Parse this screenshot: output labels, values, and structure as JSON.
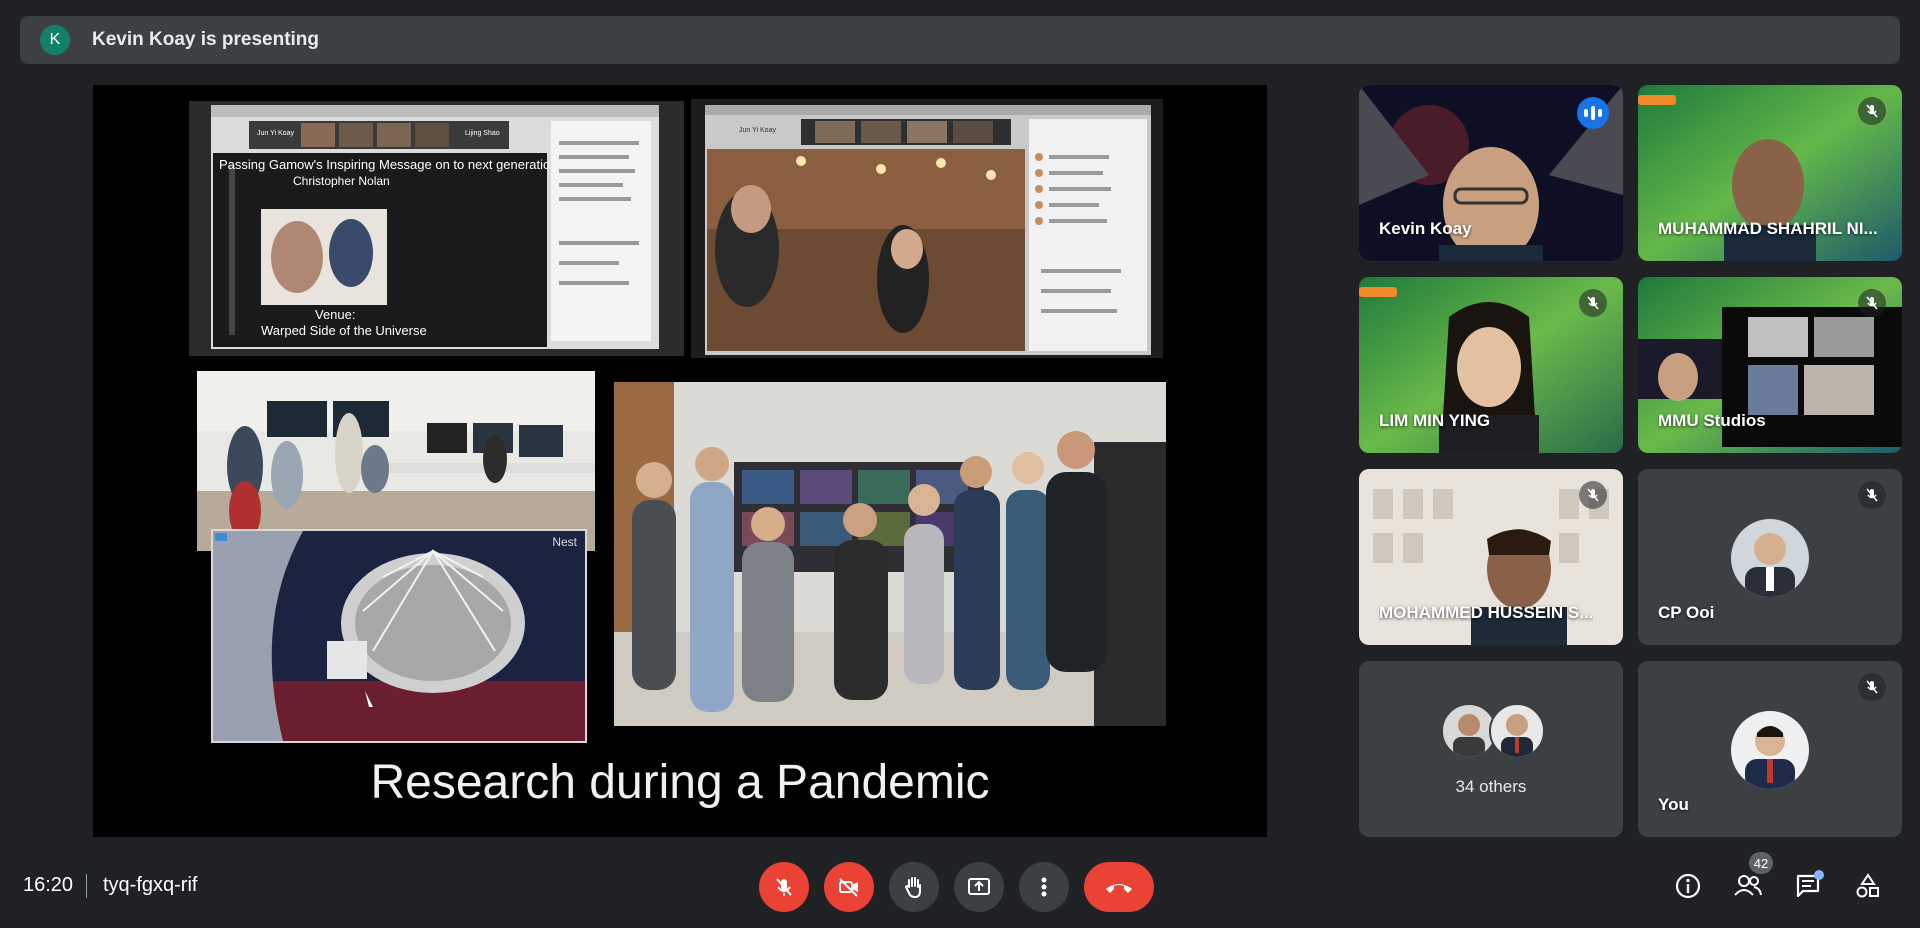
{
  "banner": {
    "avatar_letter": "K",
    "text": "Kevin Koay is presenting"
  },
  "presentation": {
    "caption": "Research during a Pandemic",
    "slide_texts": {
      "title": "Passing Gamow's Inspiring Message on to next generation",
      "speaker": "Christopher Nolan",
      "venue_label": "Venue:",
      "venue": "Warped Side of the Universe",
      "name_tag_left": "Jun Yi Koay",
      "name_tag_right": "Lijing Shao",
      "name_tag_top_right": "Jun Yi Koay",
      "camera_label": "Nest"
    }
  },
  "participants": [
    {
      "name": "Kevin Koay",
      "muted": false,
      "speaking": true,
      "active": true
    },
    {
      "name": "MUHAMMAD SHAHRIL NI...",
      "muted": true
    },
    {
      "name": "LIM MIN YING",
      "muted": true
    },
    {
      "name": "MMU Studios",
      "muted": true
    },
    {
      "name": "MOHAMMED HUSSEIN S...",
      "muted": true
    },
    {
      "name": "CP Ooi",
      "muted": true
    },
    {
      "name": "34 others"
    },
    {
      "name": "You",
      "muted": true
    }
  ],
  "meeting": {
    "time": "16:20",
    "code": "tyq-fgxq-rif",
    "participant_count": "42"
  },
  "controls": {
    "mic": "mic-off-icon",
    "camera": "camera-off-icon",
    "hand": "raise-hand-icon",
    "present": "present-screen-icon",
    "more": "more-options-icon",
    "leave": "leave-call-icon"
  },
  "colors": {
    "accent": "#8ab4f8",
    "danger": "#ea4335",
    "surface": "#3c4043",
    "background": "#202124"
  }
}
